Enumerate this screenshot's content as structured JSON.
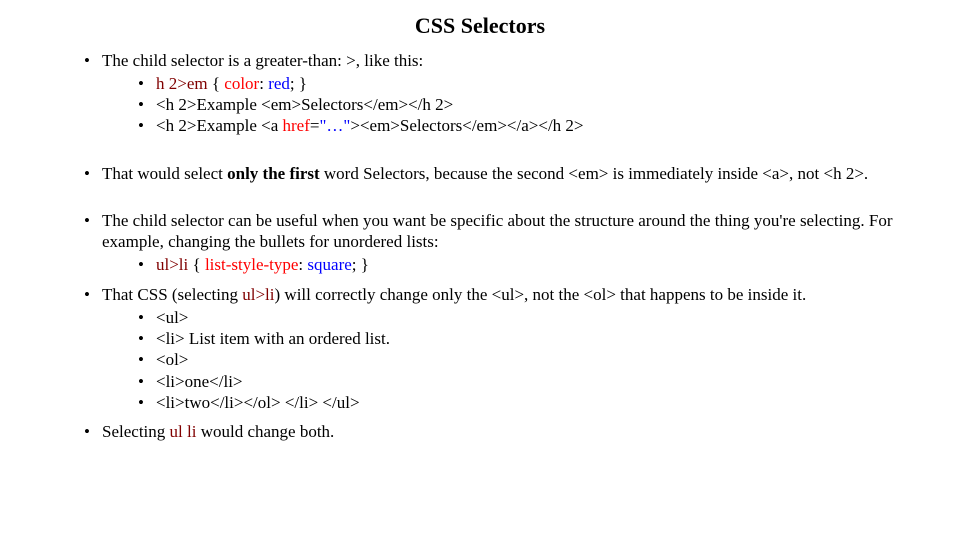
{
  "title": "CSS Selectors",
  "b1": {
    "lead": "The child selector is a greater-than: >, like this:",
    "s1": {
      "sel": "h 2>em",
      "brace_l": " { ",
      "prop": "color",
      "colon": ": ",
      "val": "red",
      "end": "; }"
    },
    "s2": {
      "open": "<h 2>",
      "t1": "Example ",
      "emO": "<em>",
      "mid": "Selectors",
      "emC": "</em>",
      "close": "</h 2>"
    },
    "s3": {
      "open": "<h 2>",
      "t1": "Example ",
      "aO": "<a ",
      "href": "href",
      "eq": "=",
      "q": "\"…\"",
      "gt": ">",
      "emO": "<em>",
      "mid": "Selectors",
      "emC": "</em>",
      "aC": "</a>",
      "close": "</h 2>"
    }
  },
  "b2": {
    "p1": "That would select ",
    "strong": "only the first",
    "p2": " word Selectors, because the second <em> is immediately inside <a>, not <h 2>."
  },
  "b3": {
    "lead": "The child selector can be useful when you want be specific about the structure around the thing you're selecting. For example, changing the bullets for unordered lists:",
    "s1": {
      "sel": "ul>li",
      "brace_l": " { ",
      "prop": "list-style-type",
      "colon": ": ",
      "val": "square",
      "end": "; }"
    }
  },
  "b4": {
    "lead": "That CSS (selecting ",
    "sel": "ul>li",
    "tail": ") will correctly change only the <ul>, not the <ol> that happens to be inside it.",
    "s1": "<ul>",
    "s2": "<li> List item with an ordered list.",
    "s3": "<ol>",
    "s4": "<li>one</li>",
    "s5": "<li>two</li></ol> </li> </ul>"
  },
  "b5": {
    "p1": "Selecting ",
    "sel": "ul li",
    "p2": " would change both."
  }
}
